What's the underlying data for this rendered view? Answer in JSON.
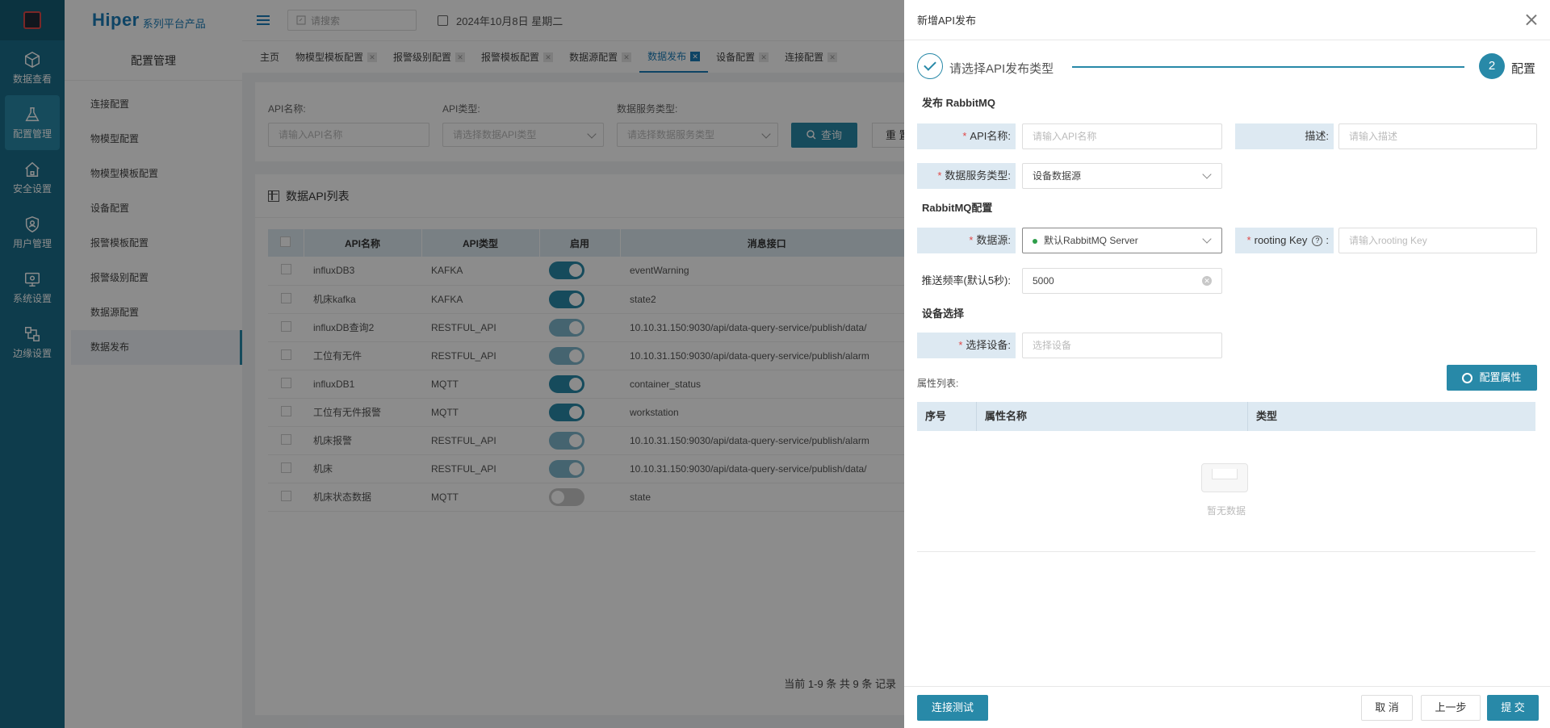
{
  "rail": {
    "items": [
      {
        "label": "数据查看",
        "icon": "cube-icon"
      },
      {
        "label": "配置管理",
        "icon": "flask-icon"
      },
      {
        "label": "安全设置",
        "icon": "home-lock-icon"
      },
      {
        "label": "用户管理",
        "icon": "shield-user-icon"
      },
      {
        "label": "系统设置",
        "icon": "monitor-gear-icon"
      },
      {
        "label": "边缘设置",
        "icon": "nodes-icon"
      }
    ]
  },
  "brand": {
    "name": "Hiper",
    "suffix": "系列平台产品"
  },
  "sidebar": {
    "title": "配置管理",
    "items": [
      "连接配置",
      "物模型配置",
      "物模型模板配置",
      "设备配置",
      "报警模板配置",
      "报警级别配置",
      "数据源配置",
      "数据发布"
    ]
  },
  "topbar": {
    "search_placeholder": "请搜索",
    "date": "2024年10月8日 星期二"
  },
  "tabs": [
    "主页",
    "物模型模板配置",
    "报警级别配置",
    "报警模板配置",
    "数据源配置",
    "数据发布",
    "设备配置",
    "连接配置"
  ],
  "filter": {
    "api_name_label": "API名称:",
    "api_name_placeholder": "请输入API名称",
    "api_type_label": "API类型:",
    "api_type_placeholder": "请选择数据API类型",
    "service_type_label": "数据服务类型:",
    "service_type_placeholder": "请选择数据服务类型",
    "query_label": "查询",
    "reset_label": "重 置"
  },
  "list": {
    "title": "数据API列表",
    "columns": [
      "API名称",
      "API类型",
      "启用",
      "消息接口"
    ],
    "rows": [
      {
        "name": "influxDB3",
        "type": "KAFKA",
        "enabled": "on",
        "endpoint": "eventWarning"
      },
      {
        "name": "机床kafka",
        "type": "KAFKA",
        "enabled": "on",
        "endpoint": "state2"
      },
      {
        "name": "influxDB查询2",
        "type": "RESTFUL_API",
        "enabled": "dim",
        "endpoint": "10.10.31.150:9030/api/data-query-service/publish/data/"
      },
      {
        "name": "工位有无件",
        "type": "RESTFUL_API",
        "enabled": "dim",
        "endpoint": "10.10.31.150:9030/api/data-query-service/publish/alarm"
      },
      {
        "name": "influxDB1",
        "type": "MQTT",
        "enabled": "on",
        "endpoint": "container_status"
      },
      {
        "name": "工位有无件报警",
        "type": "MQTT",
        "enabled": "on",
        "endpoint": "workstation"
      },
      {
        "name": "机床报警",
        "type": "RESTFUL_API",
        "enabled": "dim",
        "endpoint": "10.10.31.150:9030/api/data-query-service/publish/alarm"
      },
      {
        "name": "机床",
        "type": "RESTFUL_API",
        "enabled": "dim",
        "endpoint": "10.10.31.150:9030/api/data-query-service/publish/data/"
      },
      {
        "name": "机床状态数据",
        "type": "MQTT",
        "enabled": "off",
        "endpoint": "state"
      }
    ],
    "pager": "当前 1-9 条 共 9 条 记录"
  },
  "drawer": {
    "title": "新增API发布",
    "step1": "请选择API发布类型",
    "step2_num": "2",
    "step2": "配置",
    "section_publish": "发布 RabbitMQ",
    "api_name_label": "API名称:",
    "api_name_placeholder": "请输入API名称",
    "desc_label": "描述:",
    "desc_placeholder": "请输入描述",
    "service_type_label": "数据服务类型:",
    "service_type_value": "设备数据源",
    "section_rabbit": "RabbitMQ配置",
    "datasource_label": "数据源:",
    "datasource_value": "默认RabbitMQ Server",
    "routing_label": "rooting Key",
    "routing_colon": ":",
    "routing_placeholder": "请输入rooting Key",
    "freq_label": "推送频率(默认5秒):",
    "freq_value": "5000",
    "section_device": "设备选择",
    "device_label": "选择设备:",
    "device_placeholder": "选择设备",
    "attr_list_label": "属性列表:",
    "config_attr_label": "配置属性",
    "attr_columns": [
      "序号",
      "属性名称",
      "类型"
    ],
    "empty_text": "暂无数据",
    "test_label": "连接测试",
    "cancel_label": "取 消",
    "prev_label": "上一步",
    "submit_label": "提 交"
  }
}
